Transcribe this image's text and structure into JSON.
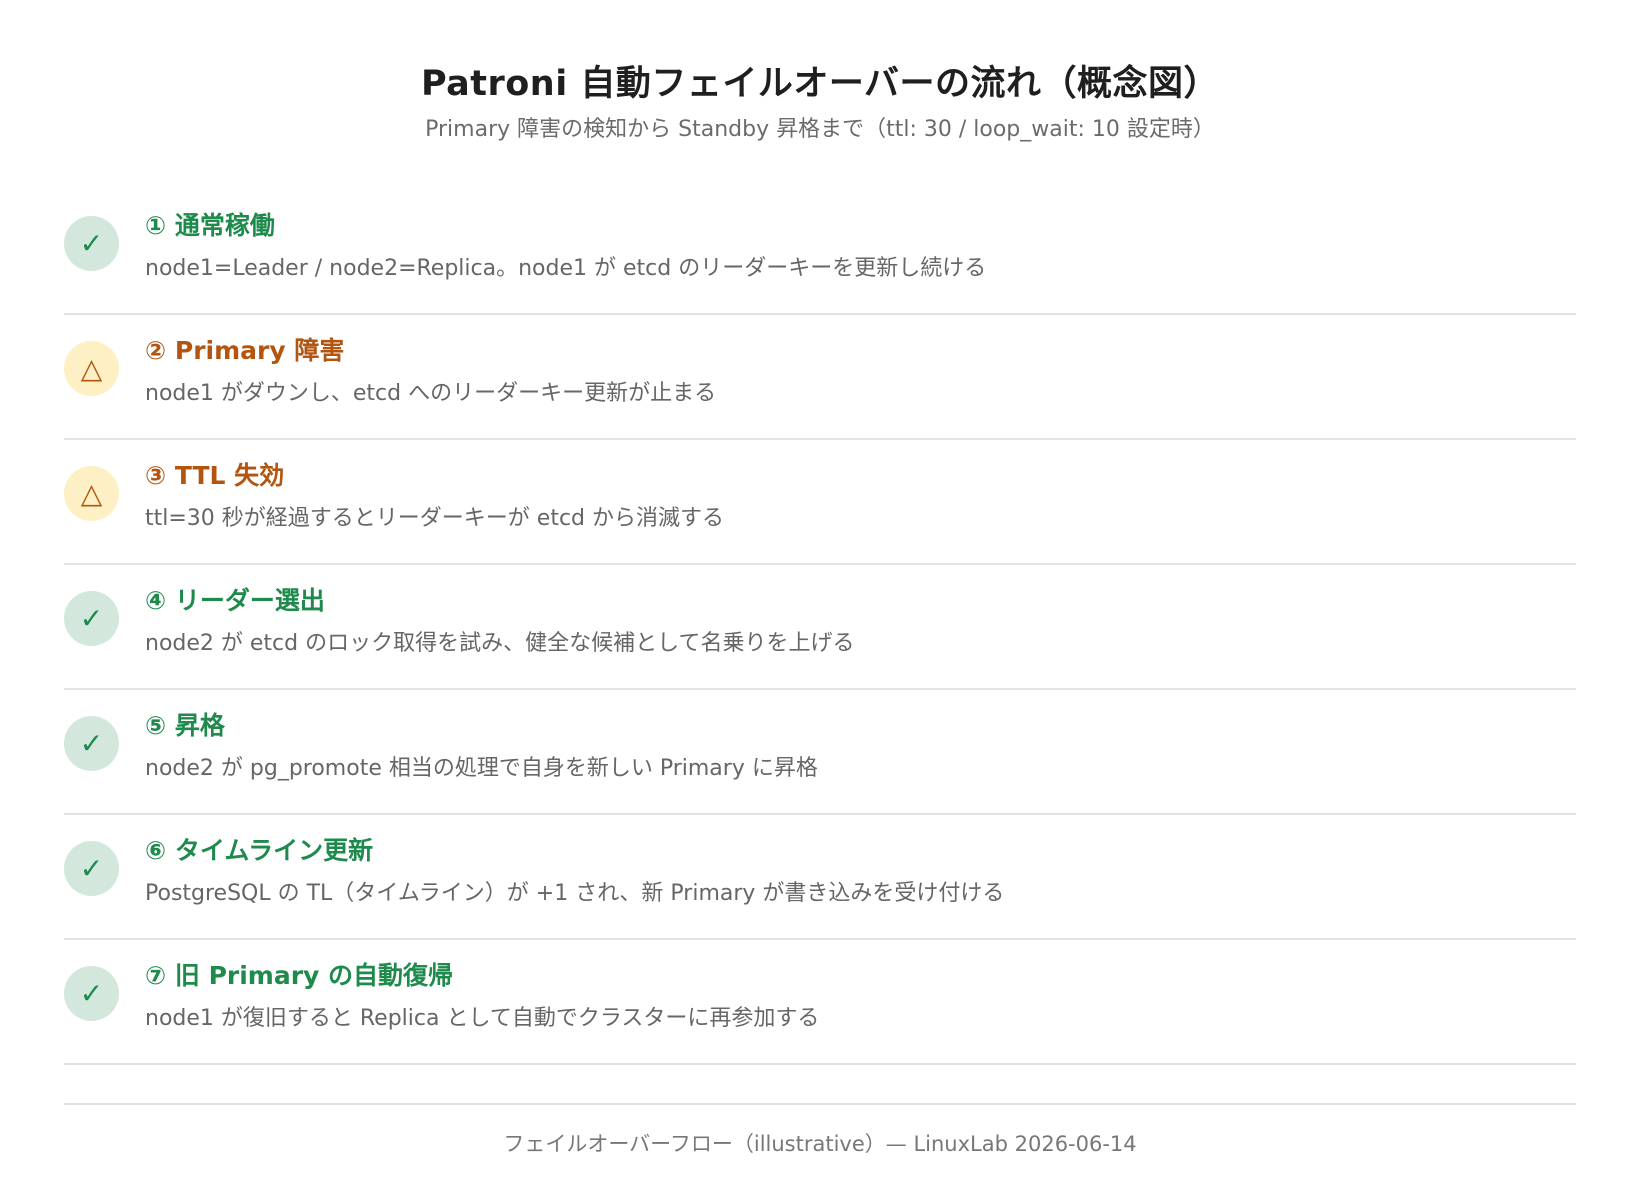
{
  "header": {
    "title": "Patroni 自動フェイルオーバーの流れ（概念図）",
    "subtitle": "Primary 障害の検知から Standby 昇格まで（ttl: 30 / loop_wait: 10 設定時）"
  },
  "steps": [
    {
      "status": "ok",
      "icon": "check-icon",
      "icon_glyph": "✓",
      "title": "① 通常稼働",
      "description": "node1=Leader / node2=Replica。node1 が etcd のリーダーキーを更新し続ける"
    },
    {
      "status": "warn",
      "icon": "warning-triangle-icon",
      "icon_glyph": "△",
      "title": "② Primary 障害",
      "description": "node1 がダウンし、etcd へのリーダーキー更新が止まる"
    },
    {
      "status": "warn",
      "icon": "warning-triangle-icon",
      "icon_glyph": "△",
      "title": "③ TTL 失効",
      "description": "ttl=30 秒が経過するとリーダーキーが etcd から消滅する"
    },
    {
      "status": "ok",
      "icon": "check-icon",
      "icon_glyph": "✓",
      "title": "④ リーダー選出",
      "description": "node2 が etcd のロック取得を試み、健全な候補として名乗りを上げる"
    },
    {
      "status": "ok",
      "icon": "check-icon",
      "icon_glyph": "✓",
      "title": "⑤ 昇格",
      "description": "node2 が pg_promote 相当の処理で自身を新しい Primary に昇格"
    },
    {
      "status": "ok",
      "icon": "check-icon",
      "icon_glyph": "✓",
      "title": "⑥ タイムライン更新",
      "description": "PostgreSQL の TL（タイムライン）が +1 され、新 Primary が書き込みを受け付ける"
    },
    {
      "status": "ok",
      "icon": "check-icon",
      "icon_glyph": "✓",
      "title": "⑦ 旧 Primary の自動復帰",
      "description": "node1 が復旧すると Replica として自動でクラスターに再参加する"
    }
  ],
  "footer": {
    "text": "フェイルオーバーフロー（illustrative）— LinuxLab 2026-06-14"
  },
  "colors": {
    "ok_text": "#1e8a4c",
    "ok_bg": "#d3e7dc",
    "warn_text": "#b3550f",
    "warn_bg": "#fdf0c4",
    "divider": "#e3e3e3"
  }
}
